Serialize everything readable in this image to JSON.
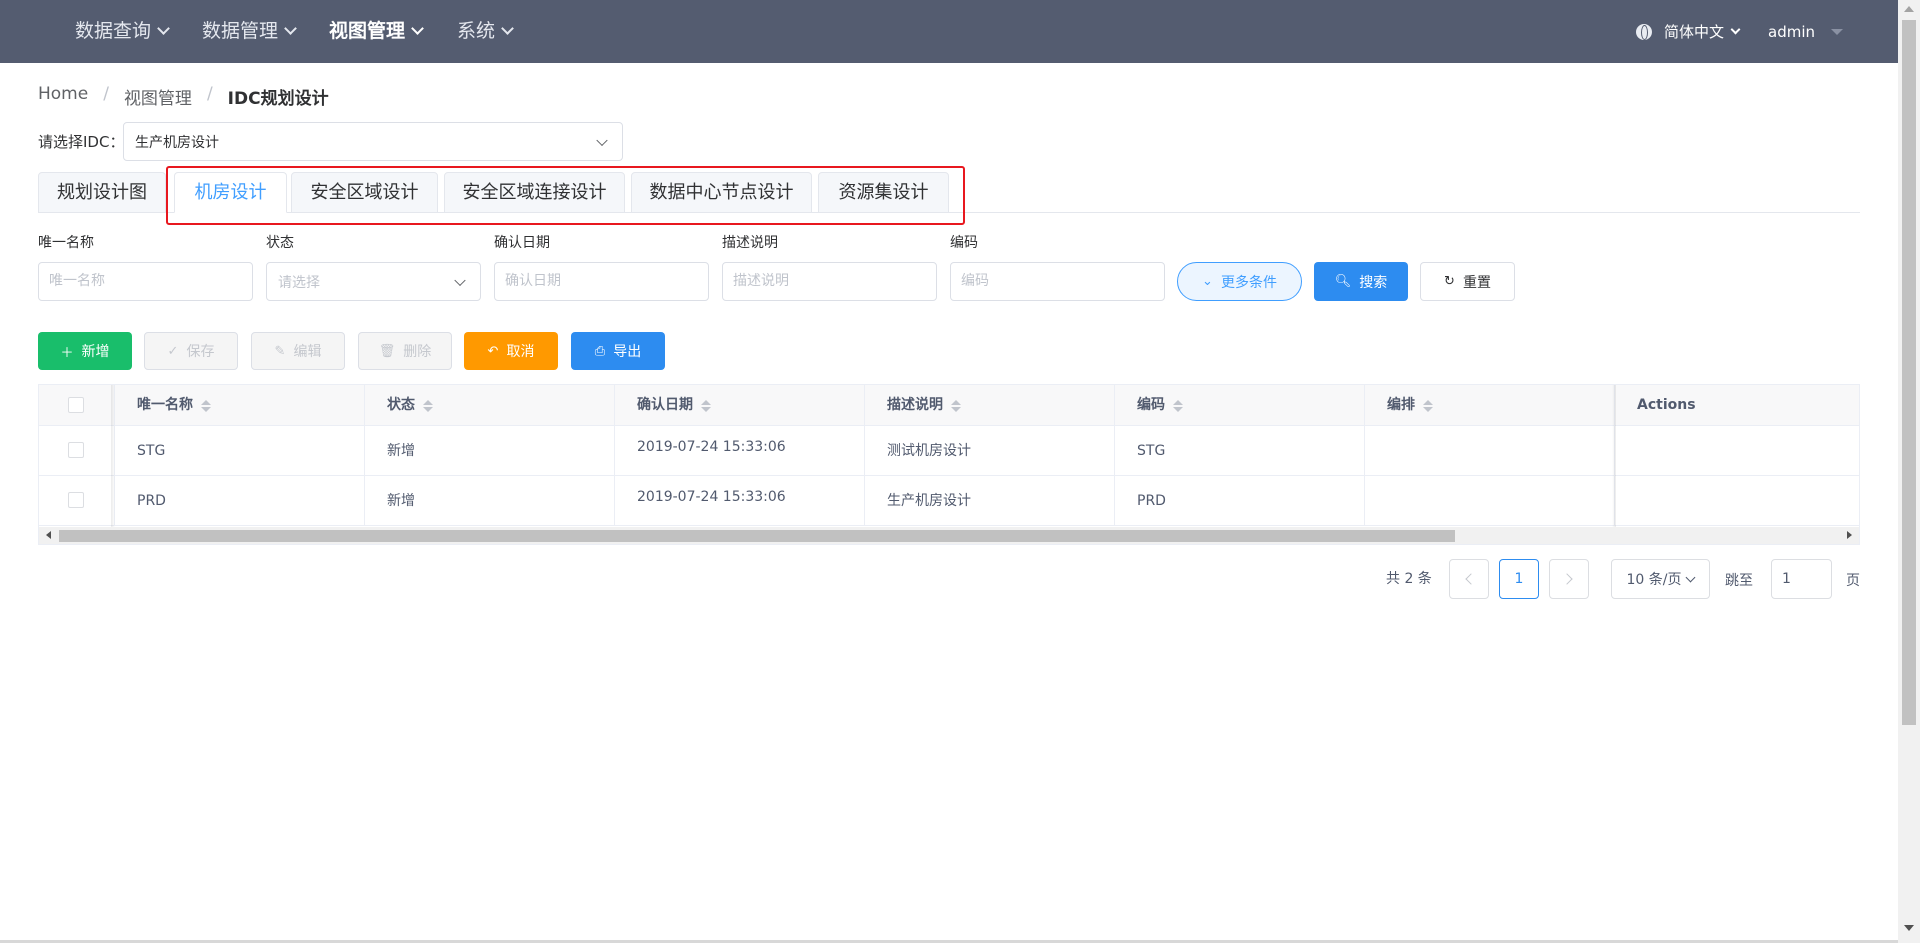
{
  "nav": {
    "items": [
      {
        "label": "数据查询"
      },
      {
        "label": "数据管理"
      },
      {
        "label": "视图管理"
      },
      {
        "label": "系统"
      }
    ],
    "language": "简体中文",
    "user": "admin"
  },
  "breadcrumb": {
    "home": "Home",
    "section": "视图管理",
    "current": "IDC规划设计"
  },
  "idc_select": {
    "label": "请选择IDC：",
    "value": "生产机房设计"
  },
  "tabs": [
    {
      "label": "规划设计图"
    },
    {
      "label": "机房设计"
    },
    {
      "label": "安全区域设计"
    },
    {
      "label": "安全区域连接设计"
    },
    {
      "label": "数据中心节点设计"
    },
    {
      "label": "资源集设计"
    }
  ],
  "active_tab": "机房设计",
  "filters": {
    "name_label": "唯一名称",
    "name_placeholder": "唯一名称",
    "status_label": "状态",
    "status_placeholder": "请选择",
    "date_label": "确认日期",
    "date_placeholder": "确认日期",
    "desc_label": "描述说明",
    "desc_placeholder": "描述说明",
    "code_label": "编码",
    "code_placeholder": "编码",
    "more_label": "更多条件",
    "search_label": "搜索",
    "reset_label": "重置"
  },
  "toolbar": {
    "add_label": "新增",
    "save_label": "保存",
    "edit_label": "编辑",
    "delete_label": "删除",
    "cancel_label": "取消",
    "export_label": "导出"
  },
  "table": {
    "columns": [
      "唯一名称",
      "状态",
      "确认日期",
      "描述说明",
      "编码",
      "编排",
      "Actions"
    ],
    "rows": [
      {
        "name": "STG",
        "status": "新增",
        "date": "2019-07-24 15:33:06",
        "desc": "测试机房设计",
        "code": "STG",
        "order": ""
      },
      {
        "name": "PRD",
        "status": "新增",
        "date": "2019-07-24 15:33:06",
        "desc": "生产机房设计",
        "code": "PRD",
        "order": ""
      }
    ]
  },
  "pagination": {
    "total_text": "共 2 条",
    "current_page": "1",
    "page_size": "10 条/页",
    "jump_label": "跳至",
    "jump_value": "1",
    "page_suffix": "页"
  },
  "colors": {
    "topbar": "#545c70",
    "primary": "#2d8cf0",
    "success": "#19be6b",
    "warning": "#ff9900",
    "highlight_box": "#e8181f"
  }
}
